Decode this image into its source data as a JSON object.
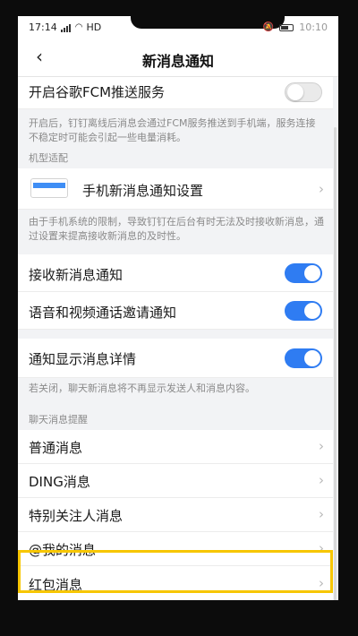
{
  "status_bar": {
    "time": "17:14",
    "network": "HD",
    "right_time": "10:10"
  },
  "nav": {
    "back_icon": "chevron-left-icon",
    "title": "新消息通知"
  },
  "settings": {
    "fcm": {
      "label": "开启谷歌FCM推送服务",
      "enabled": false,
      "note": "开启后，钉钉离线后消息会通过FCM服务推送到手机端，服务连接不稳定时可能会引起一些电量消耗。"
    },
    "device_section": "机型适配",
    "device_setting": {
      "label": "手机新消息通知设置",
      "icon": "phone-settings-icon"
    },
    "device_note": "由于手机系统的限制，导致钉钉在后台有时无法及时接收新消息，通过设置来提高接收新消息的及时性。",
    "receive": {
      "label": "接收新消息通知",
      "enabled": true
    },
    "voice_video": {
      "label": "语音和视频通话邀请通知",
      "enabled": true
    },
    "show_detail": {
      "label": "通知显示消息详情",
      "enabled": true
    },
    "detail_note": "若关闭，聊天新消息将不再显示发送人和消息内容。",
    "chat_section": "聊天消息提醒",
    "chat_items": [
      {
        "label": "普通消息"
      },
      {
        "label": "DING消息"
      },
      {
        "label": "特别关注人消息"
      },
      {
        "label": "@我的消息"
      },
      {
        "label": "红包消息"
      }
    ]
  },
  "colors": {
    "accent": "#2f7cf2",
    "highlight": "#f7c600",
    "background": "#f2f3f5"
  }
}
